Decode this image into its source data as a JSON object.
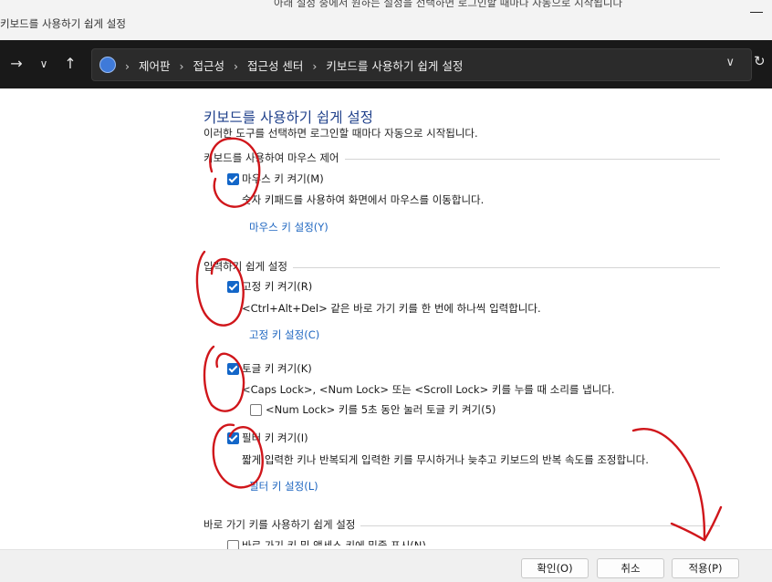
{
  "window": {
    "title": "키보드를 사용하기 쉽게 설정",
    "background_text": "아래 설정 중에서 원하는 설정을 선택하면 로그인할 때마다 자동으로 시작됩니다"
  },
  "nav": {
    "forward_icon": "arrow-right-icon",
    "recent_icon": "chevron-down-icon",
    "up_icon": "arrow-up-icon",
    "breadcrumbs": [
      "제어판",
      "접근성",
      "접근성 센터",
      "키보드를 사용하기 쉽게 설정"
    ],
    "refresh_icon": "refresh-icon"
  },
  "page": {
    "heading": "키보드를 사용하기 쉽게 설정",
    "intro": "이러한 도구를 선택하면 로그인할 때마다 자동으로 시작됩니다."
  },
  "groups": {
    "mouse": {
      "label": "키보드를 사용하여 마우스 제어",
      "mousekeys": {
        "label": "마우스 키 켜기(M)",
        "checked": true,
        "desc": "숫자 키패드를 사용하여 화면에서 마우스를 이동합니다.",
        "link": "마우스 키 설정(Y)"
      }
    },
    "typing": {
      "label": "입력하기 쉽게 설정",
      "stickykeys": {
        "label": "고정 키 켜기(R)",
        "checked": true,
        "desc": "<Ctrl+Alt+Del> 같은 바로 가기 키를 한 번에 하나씩 입력합니다.",
        "link": "고정 키 설정(C)"
      },
      "togglekeys": {
        "label": "토글 키 켜기(K)",
        "checked": true,
        "desc": "<Caps Lock>, <Num Lock> 또는 <Scroll Lock> 키를 누를 때 소리를 냅니다.",
        "sub_label": "<Num Lock> 키를 5초 동안 눌러 토글 키 켜기(5)",
        "sub_checked": false
      },
      "filterkeys": {
        "label": "필터 키 켜기(I)",
        "checked": true,
        "desc": "짧게 입력한 키나 반복되게 입력한 키를 무시하거나 늦추고 키보드의 반복 속도를 조정합니다.",
        "link": "필터 키 설정(L)"
      }
    },
    "shortcuts": {
      "label": "바로 가기 키를 사용하기 쉽게 설정",
      "underline": {
        "label": "바로 가기 키 및 액세스 키에 밑줄 표시(N)",
        "checked": false
      }
    }
  },
  "footer": {
    "ok": "확인(O)",
    "cancel": "취소",
    "apply": "적용(P)"
  },
  "colors": {
    "heading": "#1e3f8a",
    "link": "#1e66c0",
    "checkbox": "#1366c8",
    "annotation": "#d0161b"
  }
}
